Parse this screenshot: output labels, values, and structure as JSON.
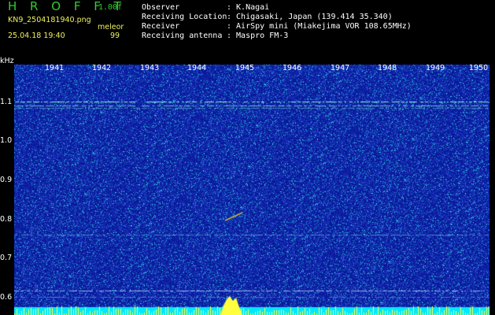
{
  "header": {
    "title": "H R O F F T",
    "version": "1.00f",
    "filename": "KN9_2504181940.png",
    "software": "meleor",
    "datetime": "25.04.18 19:40",
    "count": "99"
  },
  "info": [
    {
      "label": "Observer",
      "value": ": K.Nagai"
    },
    {
      "label": "Receiving Location",
      "value": ": Chigasaki, Japan (139.414 35.340)"
    },
    {
      "label": "Receiver",
      "value": ": AirSpy mini (Miakejima VOR 108.65MHz)"
    },
    {
      "label": "Receiving antenna",
      "value": ": Maspro FM-3"
    }
  ],
  "axis": {
    "unit": "kHz",
    "y_ticks": [
      "1.1",
      "1.0",
      "0.9",
      "0.8",
      "0.7",
      "0.6"
    ],
    "x_ticks": [
      "1941",
      "1942",
      "1943",
      "1944",
      "1945",
      "1946",
      "1947",
      "1948",
      "1949",
      "1950"
    ]
  },
  "colors": {
    "background": "#0a1a9a",
    "noise_low": "#1c3cc8",
    "noise_high": "#30e0e0",
    "signal": "#ffff40",
    "baseline": "#00e8ff"
  }
}
